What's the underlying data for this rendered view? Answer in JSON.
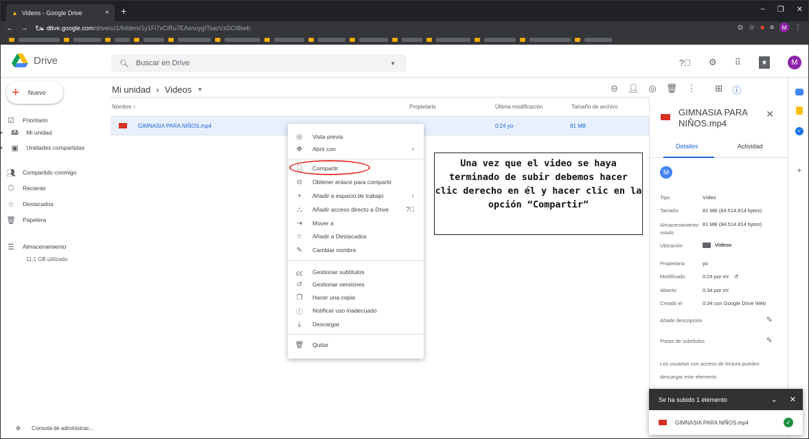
{
  "browser": {
    "tab_title": "Videos - Google Drive",
    "tab_close": "×",
    "new_tab": "+",
    "url_host": "drive.google.com",
    "url_path": "/drive/u/1/folders/1y1Fi7xCiRu7EAsnuygITsazVzDCIBiwb",
    "window_controls": [
      "–",
      "❐",
      "✕"
    ]
  },
  "header": {
    "app_name": "Drive",
    "search_placeholder": "Buscar en Drive",
    "avatar_letter": "M"
  },
  "sidebar": {
    "new_label": "Nuevo",
    "items": [
      {
        "label": "Prioritario",
        "icon": "check-circle-icon"
      },
      {
        "label": "Mi unidad",
        "icon": "my-drive-icon"
      },
      {
        "label": "Unidades compartidas",
        "icon": "shared-drives-icon"
      },
      {
        "label": "Compartido conmigo",
        "icon": "shared-with-me-icon"
      },
      {
        "label": "Reciente",
        "icon": "clock-icon"
      },
      {
        "label": "Destacados",
        "icon": "star-icon"
      },
      {
        "label": "Papelera",
        "icon": "trash-icon"
      },
      {
        "label": "Almacenamiento",
        "icon": "storage-icon"
      }
    ],
    "storage_used": "11,1 GB utilizado",
    "admin_console": "Consola de administrac..."
  },
  "main": {
    "breadcrumb_root": "Mi unidad",
    "breadcrumb_sep": "›",
    "breadcrumb_current": "Videos",
    "columns": {
      "name": "Nombre ↑",
      "owner": "Propietario",
      "modified": "Última modificación",
      "size": "Tamaño de archivo"
    },
    "file": {
      "name": "GIMNASIA PARA NIÑOS.mp4",
      "modified": "0:24 yo",
      "size": "81 MB"
    }
  },
  "context_menu": {
    "items": [
      {
        "label": "Vista previa",
        "icon": "eye-icon"
      },
      {
        "label": "Abrir con",
        "icon": "open-with-icon",
        "submenu": true
      },
      {
        "label": "Compartir",
        "icon": "add-person-icon"
      },
      {
        "label": "Obtener enlace para compartir",
        "icon": "link-icon"
      },
      {
        "label": "Añadir a espacio de trabajo",
        "icon": "plus-icon",
        "submenu": true
      },
      {
        "label": "Añadir acceso directo a Drive",
        "icon": "shortcut-icon",
        "help": true
      },
      {
        "label": "Mover a",
        "icon": "move-icon"
      },
      {
        "label": "Añadir a Destacados",
        "icon": "star-icon"
      },
      {
        "label": "Cambiar nombre",
        "icon": "pencil-icon"
      },
      {
        "label": "Gestionar subtítulos",
        "icon": "cc-icon"
      },
      {
        "label": "Gestionar versiones",
        "icon": "history-icon"
      },
      {
        "label": "Hacer una copia",
        "icon": "copy-icon"
      },
      {
        "label": "Notificar uso inadecuado",
        "icon": "alert-icon"
      },
      {
        "label": "Descargar",
        "icon": "download-icon"
      },
      {
        "label": "Quitar",
        "icon": "trash-icon"
      }
    ]
  },
  "annotation": {
    "lines": [
      "Una vez que el video se haya",
      "terminado de subir debemos hacer",
      "clic derecho en él y hacer clic en la",
      "opción “Compartir”"
    ]
  },
  "details": {
    "title": "GIMNASIA PARA NIÑOS.mp4",
    "tab_details": "Detalles",
    "tab_activity": "Actividad",
    "avatar_letter": "M",
    "props": [
      {
        "label": "Tipo",
        "value": "Vídeo"
      },
      {
        "label": "Tamaño",
        "value": "81 MB (84.514.814 bytes)"
      },
      {
        "label": "Almacenamiento usado",
        "value": "81 MB (84.514.814 bytes)"
      },
      {
        "label": "Ubicación",
        "value": "Videos"
      },
      {
        "label": "Propietario",
        "value": "yo"
      },
      {
        "label": "Modificado",
        "value": "0:24 por mí"
      },
      {
        "label": "Abierto",
        "value": "0:34 por mí"
      },
      {
        "label": "Creado el",
        "value": "0:34 con Google Drive Web"
      }
    ],
    "add_description": "Añadir descripción",
    "subtitles_hint": "Pistas de subtítulos",
    "access_note_1": "Los usuarios con acceso de lectura pueden",
    "access_note_2": "descargar este elemento"
  },
  "upload_toast": {
    "title": "Se ha subido 1 elemento",
    "file": "GIMNASIA PARA NIÑOS.mp4"
  },
  "colors": {
    "accent": "#1967d2",
    "selected_row": "#e8f0fe",
    "highlight_oval": "#e53935"
  }
}
